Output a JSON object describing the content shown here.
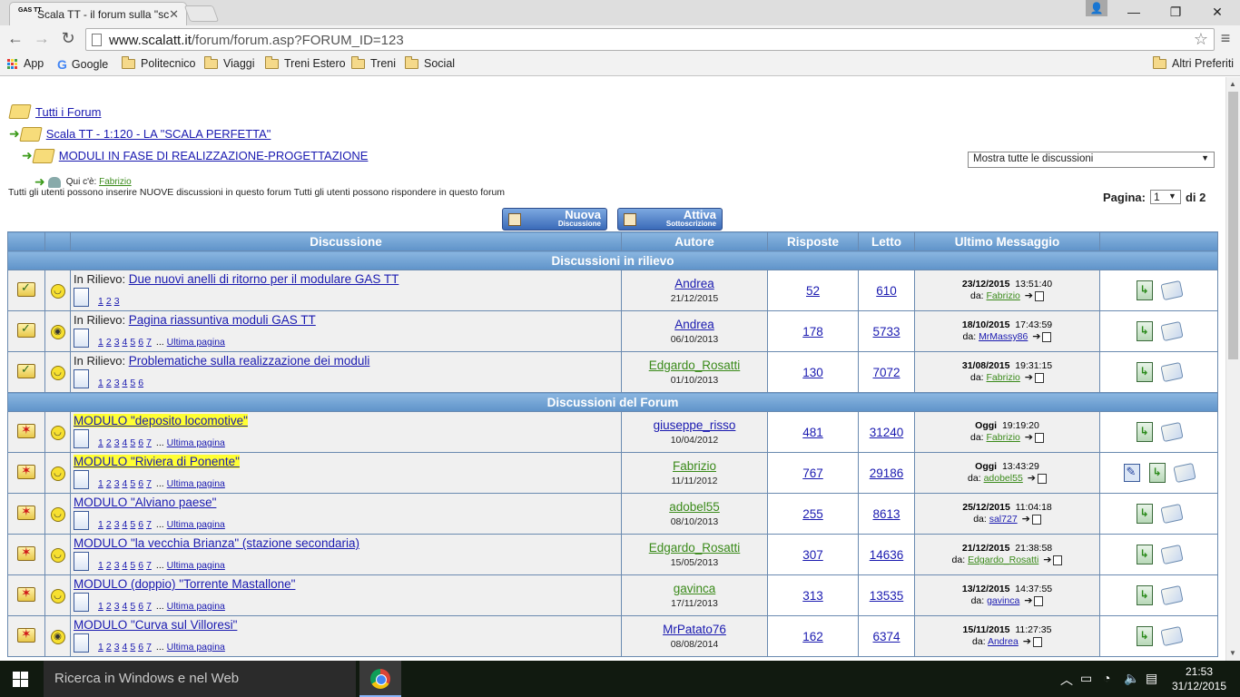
{
  "browser": {
    "tab_title": "Scala TT - il forum sulla \"sc",
    "tab_favicon": "GAS TT",
    "url_host": "www.scalatt.it",
    "url_path": "/forum/forum.asp?FORUM_ID=123",
    "bookmarks": [
      "App",
      "Google",
      "Politecnico",
      "Viaggi",
      "Treni Estero",
      "Treni",
      "Social"
    ],
    "other_bookmarks": "Altri Preferiti"
  },
  "breadcrumbs": {
    "all_forums": "Tutti i Forum",
    "category": "Scala TT - 1:120 - LA \"SCALA PERFETTA\"",
    "forum": "MODULI IN FASE DI REALIZZAZIONE-PROGETTAZIONE"
  },
  "who_is_here": {
    "label": "Qui c'è:",
    "user": "Fabrizio"
  },
  "permissions": "Tutti gli utenti possono inserire NUOVE discussioni in questo forum Tutti gli utenti possono rispondere in questo forum",
  "filter": {
    "selected": "Mostra tutte le discussioni"
  },
  "pagination": {
    "label": "Pagina:",
    "current": "1",
    "of": "di 2"
  },
  "buttons": {
    "new_big": "Nuova",
    "new_small": "Discussione",
    "sub_big": "Attiva",
    "sub_small": "Sottoscrizione"
  },
  "table": {
    "headers": {
      "topic": "Discussione",
      "author": "Autore",
      "replies": "Risposte",
      "read": "Letto",
      "last": "Ultimo Messaggio"
    },
    "section_pinned": "Discussioni in rilievo",
    "section_forum": "Discussioni del Forum",
    "pinned_prefix": "In Rilievo:",
    "last_page_label": "Ultima pagina",
    "by_label": "da:",
    "pinned": [
      {
        "title": "Due nuovi anelli di ritorno per il modulare GAS TT",
        "pages": [
          "1",
          "2",
          "3"
        ],
        "more": false,
        "author": "Andrea",
        "author_color": "blue",
        "author_date": "21/12/2015",
        "replies": "52",
        "read": "610",
        "last_date": "23/12/2015",
        "last_time": "13:51:40",
        "last_by": "Fabrizio",
        "last_by_color": "green",
        "smile": "happy",
        "edit": false
      },
      {
        "title": "Pagina riassuntiva moduli GAS TT",
        "pages": [
          "1",
          "2",
          "3",
          "4",
          "5",
          "6",
          "7"
        ],
        "more": true,
        "author": "Andrea",
        "author_color": "blue",
        "author_date": "06/10/2013",
        "replies": "178",
        "read": "5733",
        "last_date": "18/10/2015",
        "last_time": "17:43:59",
        "last_by": "MrMassy86",
        "last_by_color": "blue",
        "smile": "glasses",
        "edit": false
      },
      {
        "title": "Problematiche sulla realizzazione dei moduli",
        "pages": [
          "1",
          "2",
          "3",
          "4",
          "5",
          "6"
        ],
        "more": false,
        "author": "Edgardo_Rosatti",
        "author_color": "green",
        "author_date": "01/10/2013",
        "replies": "130",
        "read": "7072",
        "last_date": "31/08/2015",
        "last_time": "19:31:15",
        "last_by": "Fabrizio",
        "last_by_color": "green",
        "smile": "happy",
        "edit": false
      }
    ],
    "topics": [
      {
        "title": "MODULO \"deposito locomotive\"",
        "highlight": true,
        "pages": [
          "1",
          "2",
          "3",
          "4",
          "5",
          "6",
          "7"
        ],
        "more": true,
        "author": "giuseppe_risso",
        "author_color": "blue",
        "author_date": "10/04/2012",
        "replies": "481",
        "read": "31240",
        "last_date": "Oggi",
        "last_time": "19:19:20",
        "last_by": "Fabrizio",
        "last_by_color": "green",
        "smile": "happy",
        "edit": false
      },
      {
        "title": "MODULO \"Riviera di Ponente\"",
        "highlight": true,
        "pages": [
          "1",
          "2",
          "3",
          "4",
          "5",
          "6",
          "7"
        ],
        "more": true,
        "author": "Fabrizio",
        "author_color": "green",
        "author_date": "11/11/2012",
        "replies": "767",
        "read": "29186",
        "last_date": "Oggi",
        "last_time": "13:43:29",
        "last_by": "adobel55",
        "last_by_color": "green",
        "smile": "happy",
        "edit": true
      },
      {
        "title": "MODULO \"Alviano paese\"",
        "highlight": false,
        "pages": [
          "1",
          "2",
          "3",
          "4",
          "5",
          "6",
          "7"
        ],
        "more": true,
        "author": "adobel55",
        "author_color": "green",
        "author_date": "08/10/2013",
        "replies": "255",
        "read": "8613",
        "last_date": "25/12/2015",
        "last_time": "11:04:18",
        "last_by": "sal727",
        "last_by_color": "blue",
        "smile": "happy",
        "edit": false
      },
      {
        "title": "MODULO \"la vecchia Brianza\" (stazione secondaria)",
        "highlight": false,
        "pages": [
          "1",
          "2",
          "3",
          "4",
          "5",
          "6",
          "7"
        ],
        "more": true,
        "author": "Edgardo_Rosatti",
        "author_color": "green",
        "author_date": "15/05/2013",
        "replies": "307",
        "read": "14636",
        "last_date": "21/12/2015",
        "last_time": "21:38:58",
        "last_by": "Edgardo_Rosatti",
        "last_by_color": "green",
        "smile": "happy",
        "edit": false
      },
      {
        "title": "MODULO (doppio) \"Torrente Mastallone\"",
        "highlight": false,
        "pages": [
          "1",
          "2",
          "3",
          "4",
          "5",
          "6",
          "7"
        ],
        "more": true,
        "author": "gavinca",
        "author_color": "green",
        "author_date": "17/11/2013",
        "replies": "313",
        "read": "13535",
        "last_date": "13/12/2015",
        "last_time": "14:37:55",
        "last_by": "gavinca",
        "last_by_color": "blue",
        "smile": "happy",
        "edit": false
      },
      {
        "title": "MODULO \"Curva sul Villoresi\"",
        "highlight": false,
        "pages": [
          "1",
          "2",
          "3",
          "4",
          "5",
          "6",
          "7"
        ],
        "more": true,
        "author": "MrPatato76",
        "author_color": "blue",
        "author_date": "08/08/2014",
        "replies": "162",
        "read": "6374",
        "last_date": "15/11/2015",
        "last_time": "11:27:35",
        "last_by": "Andrea",
        "last_by_color": "blue",
        "smile": "glasses",
        "edit": false
      }
    ]
  },
  "taskbar": {
    "search_placeholder": "Ricerca in Windows e nel Web",
    "time": "21:53",
    "date": "31/12/2015"
  }
}
